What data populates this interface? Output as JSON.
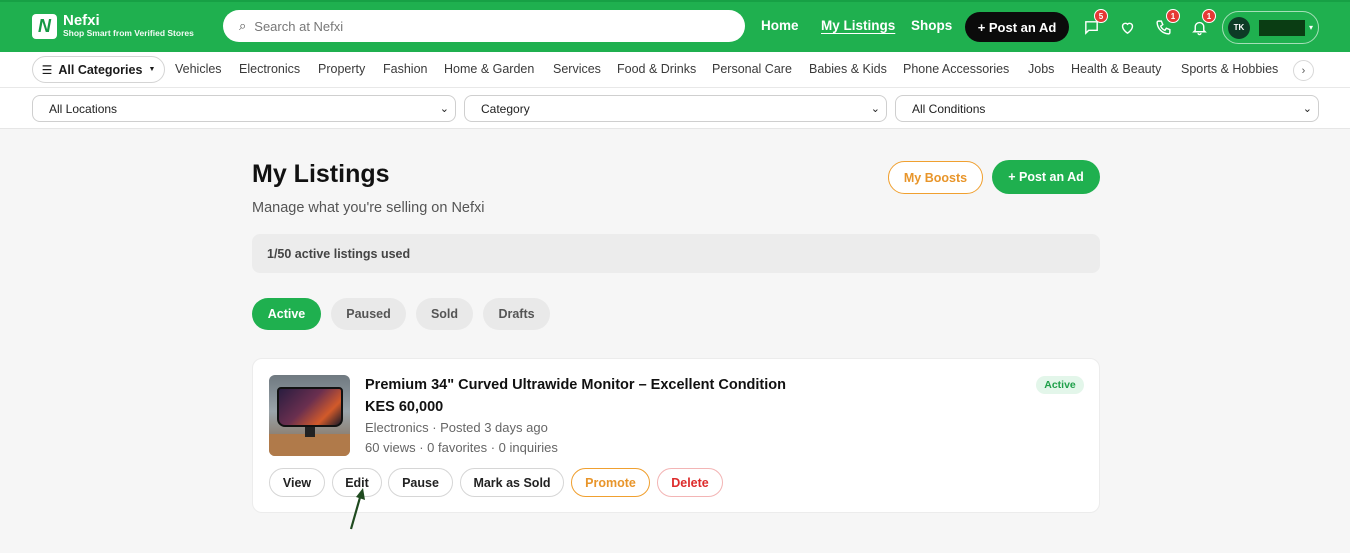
{
  "header": {
    "brand_name": "Nefxi",
    "brand_tagline": "Shop Smart from Verified Stores",
    "search_placeholder": "Search at Nefxi",
    "nav": [
      "Home",
      "My Listings",
      "Shops"
    ],
    "post_ad_label": "+ Post an Ad",
    "messages_badge": "5",
    "calls_badge": "1",
    "notifications_badge": "1",
    "avatar_initials": "TK"
  },
  "categories": {
    "all_label": "All Categories",
    "items": [
      "Vehicles",
      "Electronics",
      "Property",
      "Fashion",
      "Home & Garden",
      "Services",
      "Food & Drinks",
      "Personal Care",
      "Babies & Kids",
      "Phone Accessories",
      "Jobs",
      "Health & Beauty",
      "Sports & Hobbies"
    ]
  },
  "filters": {
    "location": "All Locations",
    "category": "Category",
    "condition": "All Conditions"
  },
  "page": {
    "title": "My Listings",
    "subtitle": "Manage what you're selling on Nefxi",
    "boosts_label": "My Boosts",
    "post_ad_label": "+ Post an Ad",
    "usage_text": "1/50 active listings used",
    "tabs": [
      "Active",
      "Paused",
      "Sold",
      "Drafts"
    ]
  },
  "listing": {
    "title": "Premium 34\" Curved Ultrawide Monitor – Excellent Condition",
    "price": "KES 60,000",
    "meta": "Electronics · Posted 3 days ago",
    "stats": "60 views · 0 favorites · 0 inquiries",
    "status": "Active",
    "actions": [
      "View",
      "Edit",
      "Pause",
      "Mark as Sold",
      "Promote",
      "Delete"
    ]
  },
  "colors": {
    "brand_green": "#1fb04f",
    "promote_orange": "#e8952a",
    "delete_red": "#dd2b2b"
  }
}
